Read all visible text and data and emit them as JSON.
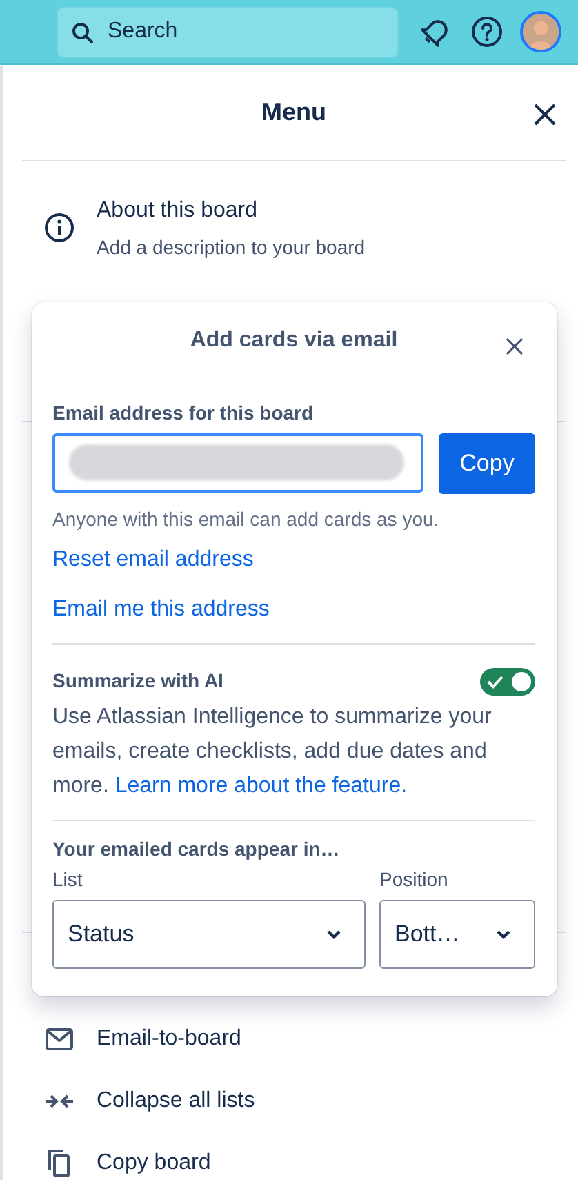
{
  "top_bar": {
    "search": {
      "placeholder": "Search"
    }
  },
  "menu": {
    "title": "Menu",
    "about": {
      "title": "About this board",
      "subtitle": "Add a description to your board"
    },
    "items": [
      {
        "kind": "email",
        "label": "Email-to-board"
      },
      {
        "kind": "collapse",
        "label": "Collapse all lists"
      },
      {
        "kind": "copy",
        "label": "Copy board"
      }
    ]
  },
  "popover": {
    "title": "Add cards via email",
    "email_label": "Email address for this board",
    "copy_button": "Copy",
    "helper": "Anyone with this email can add cards as you.",
    "links": [
      "Reset email address",
      "Email me this address"
    ],
    "ai": {
      "title": "Summarize with AI",
      "on": true,
      "text": "Use Atlassian Intelligence to summarize your emails, create checklists, add due dates and more.",
      "link": "Learn more about the feature."
    },
    "placement": {
      "title": "Your emailed cards appear in…",
      "list": {
        "label": "List",
        "value": "Status"
      },
      "position": {
        "label": "Position",
        "value": "Bott…"
      }
    }
  }
}
